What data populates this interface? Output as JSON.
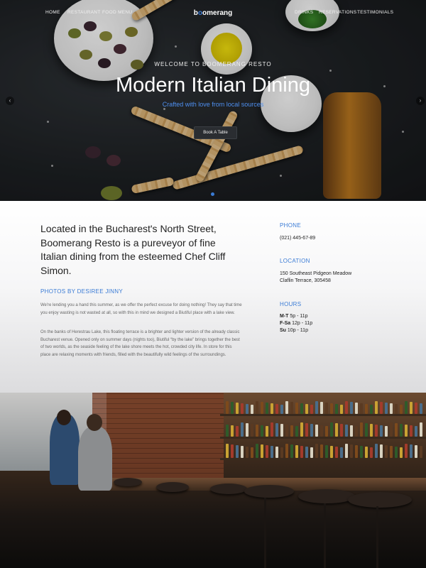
{
  "nav": {
    "left": [
      "HOME",
      "RESTAURANT",
      "FOOD MENU"
    ],
    "logo_pre": "b",
    "logo_o": "o",
    "logo_post": "omerang",
    "right": [
      "DRINKS",
      "RESERVATIONS",
      "TESTIMONIALS"
    ]
  },
  "hero": {
    "kicker": "WELCOME TO BOOMERANG RESTO",
    "headline": "Modern Italian Dining",
    "tagline": "Crafted with love from local sources",
    "button": "Book A Table",
    "prev_icon": "‹",
    "next_icon": "›",
    "slides_total": 1,
    "slide_active": 1
  },
  "about": {
    "lead": "Located in the Bucharest's North Street, Boomerang Resto is a pureveyor of fine Italian dining from the esteemed Chef Cliff Simon.",
    "photos_credit": "PHOTOS BY DESIREE JINNY",
    "para1": "We're lending you a hand this summer, as we offer the perfect excuse for doing nothing! They say that time you enjoy wasting is not wasted at all, so with this in mind we designed a Biutiful place with a lake view.",
    "para2": "On the banks of Herestrau Lake, this floating terrace is a brighter and lighter version of the already classic Bucharest venue. Opened only on summer days (nights too), Biutiful “by the lake” brings together the best of two worlds, as the seaside feeling of the lake shore meets the hot, crowded city life. In store for this place are relaxing moments with friends, filled with the beautifully wild feelings of the surroundings."
  },
  "contact": {
    "phone_label": "PHONE",
    "phone": "(021) 445-67-89",
    "location_label": "LOCATION",
    "address_line1": "150 Southeast Pidgeon Meadow",
    "address_line2": "Claflin Terrace, 305458",
    "hours_label": "HOURS",
    "hours": [
      {
        "days": "M-T",
        "time": "5p - 11p"
      },
      {
        "days": "F-Sa",
        "time": "12p - 11p"
      },
      {
        "days": "Su",
        "time": "10p - 11p"
      }
    ]
  },
  "colors": {
    "accent": "#3a7bd5",
    "hero_bg": "#1d2023",
    "text_dark": "#222222",
    "text_muted": "#666666"
  }
}
